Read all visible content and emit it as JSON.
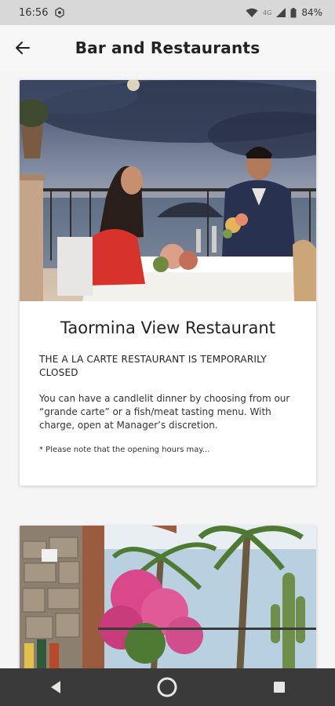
{
  "status_bar": {
    "time": "16:56",
    "network": "4G",
    "battery": "84%"
  },
  "header": {
    "title": "Bar and Restaurants"
  },
  "restaurants": [
    {
      "name": "Taormina View Restaurant",
      "status": "THE A LA CARTE RESTAURANT IS TEMPORARILY CLOSED",
      "description": "You can have a candlelit dinner by choosing from our “grande carte” or a fish/meat tasting menu. With charge, open at Manager’s discretion.",
      "note": "* Please note that the opening hours may..."
    }
  ],
  "colors": {
    "status_bar_bg": "#d8d8d8",
    "nav_bar_bg": "#3a3a3a",
    "page_bg": "#f5f5f5"
  },
  "icons": {
    "back": "arrow-left-icon",
    "wifi": "wifi-icon",
    "battery": "battery-icon",
    "nav_back": "triangle-back-icon",
    "nav_home": "circle-home-icon",
    "nav_recents": "square-recents-icon"
  }
}
